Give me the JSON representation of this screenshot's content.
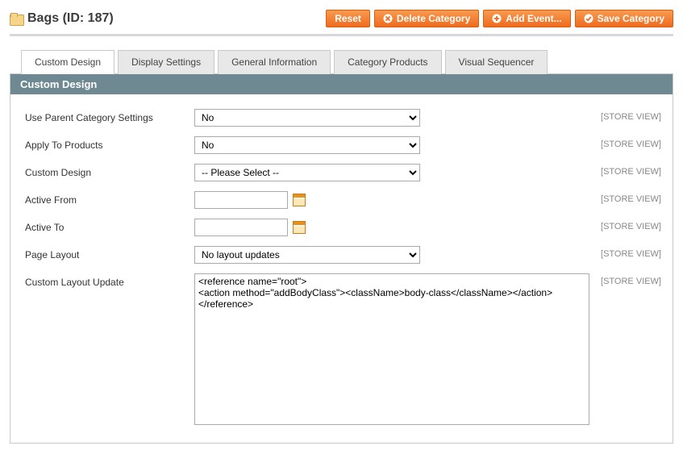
{
  "header": {
    "title": "Bags (ID: 187)",
    "buttons": {
      "reset": "Reset",
      "delete": "Delete Category",
      "addevent": "Add Event...",
      "save": "Save Category"
    }
  },
  "tabs": [
    {
      "id": "custom-design",
      "label": "Custom Design",
      "active": true
    },
    {
      "id": "display-settings",
      "label": "Display Settings",
      "active": false
    },
    {
      "id": "general-information",
      "label": "General Information",
      "active": false
    },
    {
      "id": "category-products",
      "label": "Category Products",
      "active": false
    },
    {
      "id": "visual-sequencer",
      "label": "Visual Sequencer",
      "active": false
    }
  ],
  "section": {
    "title": "Custom Design"
  },
  "scope_label": "[STORE VIEW]",
  "fields": {
    "use_parent": {
      "label": "Use Parent Category Settings",
      "value": "No"
    },
    "apply_products": {
      "label": "Apply To Products",
      "value": "No"
    },
    "custom_design": {
      "label": "Custom Design",
      "value": "-- Please Select --"
    },
    "active_from": {
      "label": "Active From",
      "value": ""
    },
    "active_to": {
      "label": "Active To",
      "value": ""
    },
    "page_layout": {
      "label": "Page Layout",
      "value": "No layout updates"
    },
    "custom_layout_update": {
      "label": "Custom Layout Update",
      "value": "<reference name=\"root\">\n<action method=\"addBodyClass\"><className>body-class</className></action>\n</reference>"
    }
  }
}
